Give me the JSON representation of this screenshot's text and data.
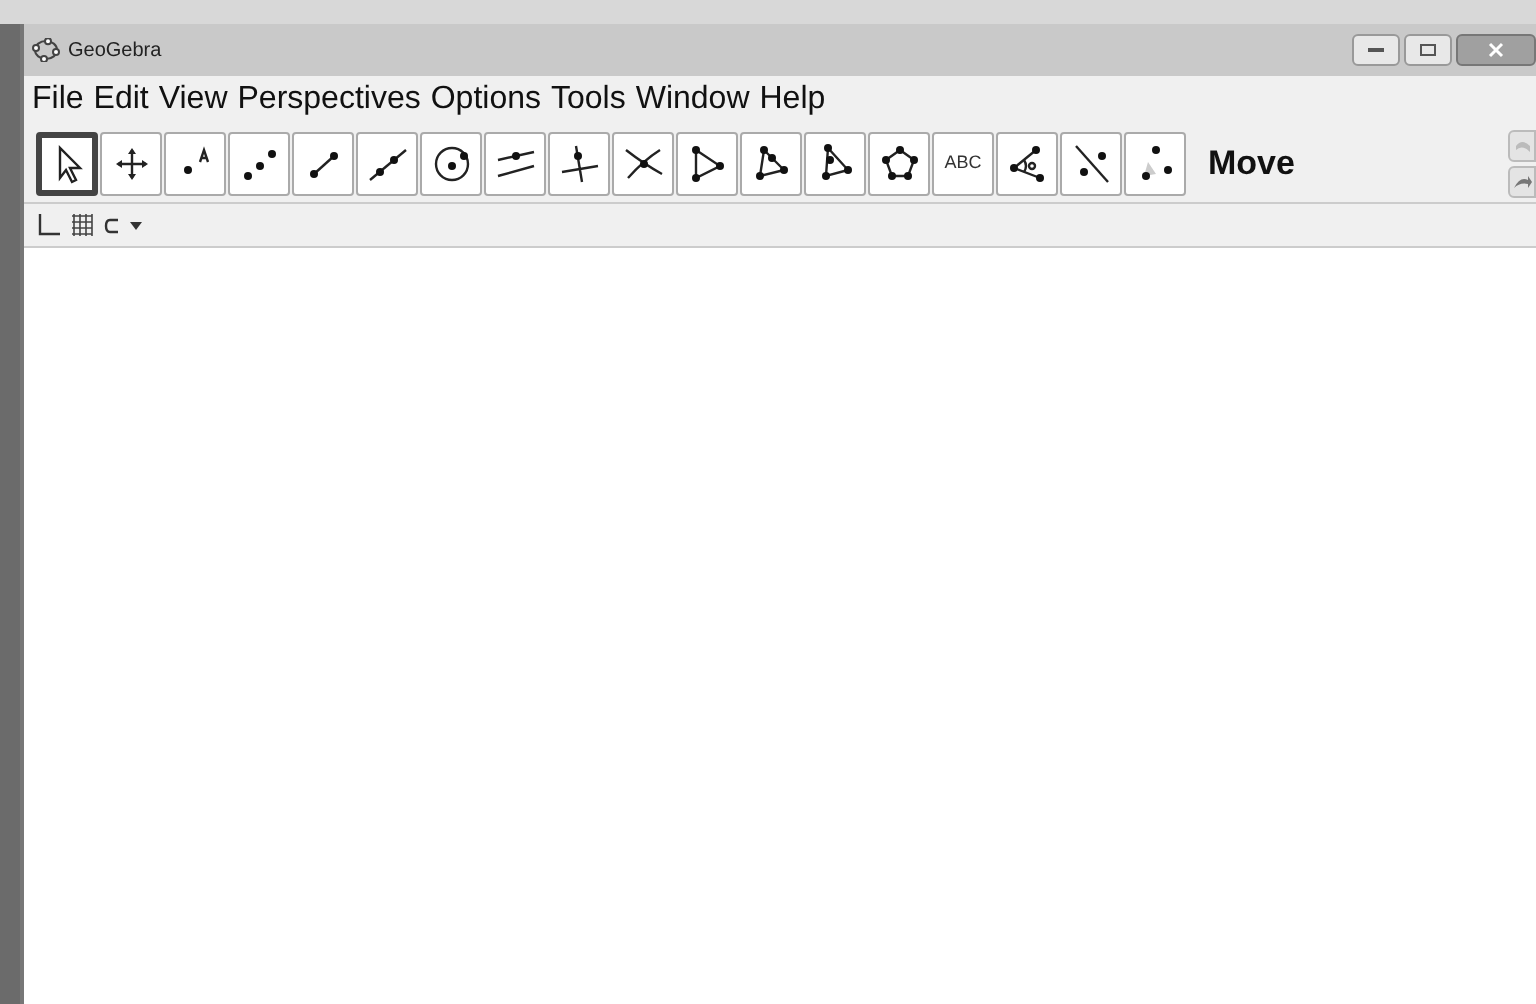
{
  "window": {
    "title": "GeoGebra"
  },
  "menu": [
    "File",
    "Edit",
    "View",
    "Perspectives",
    "Options",
    "Tools",
    "Window",
    "Help"
  ],
  "toolbar": {
    "tools": [
      {
        "kind": "move",
        "selected": true
      },
      {
        "kind": "translate",
        "selected": false
      },
      {
        "kind": "point",
        "selected": false
      },
      {
        "kind": "points",
        "selected": false
      },
      {
        "kind": "segment",
        "selected": false
      },
      {
        "kind": "line",
        "selected": false
      },
      {
        "kind": "circle",
        "selected": false
      },
      {
        "kind": "parallel",
        "selected": false
      },
      {
        "kind": "perpendicular",
        "selected": false
      },
      {
        "kind": "intersect",
        "selected": false
      },
      {
        "kind": "triangle",
        "selected": false
      },
      {
        "kind": "triangle2",
        "selected": false
      },
      {
        "kind": "triangle3",
        "selected": false
      },
      {
        "kind": "pentagon",
        "selected": false
      },
      {
        "kind": "text",
        "label": "ABC",
        "selected": false
      },
      {
        "kind": "angle",
        "selected": false
      },
      {
        "kind": "reflect",
        "selected": false
      },
      {
        "kind": "slider",
        "selected": false
      }
    ],
    "tool_name": "Move"
  }
}
